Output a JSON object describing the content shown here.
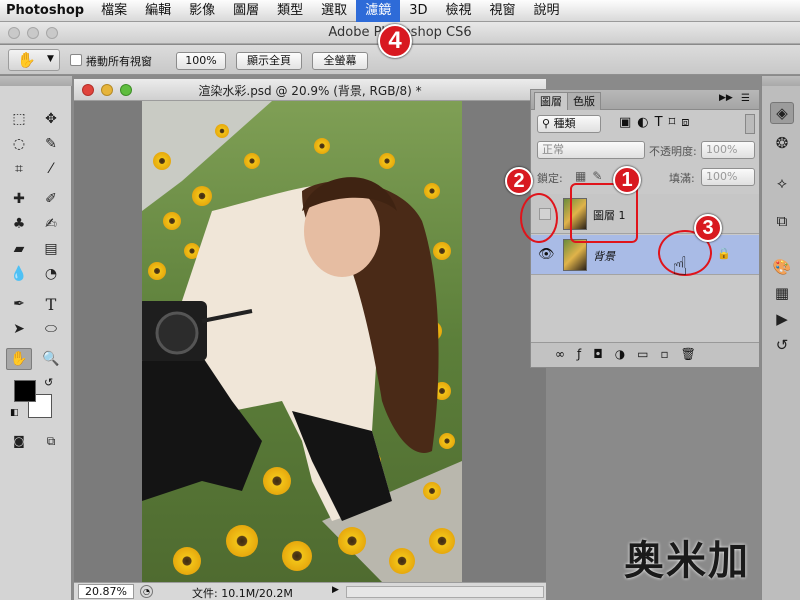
{
  "menubar": {
    "app_name": "Photoshop",
    "items": [
      "檔案",
      "編輯",
      "影像",
      "圖層",
      "類型",
      "選取",
      "濾鏡",
      "3D",
      "檢視",
      "視窗",
      "說明"
    ],
    "active_item": "濾鏡"
  },
  "window": {
    "title": "Adobe Photoshop CS6"
  },
  "options_bar": {
    "scroll_all_label": "捲動所有視窗",
    "btn_100": "100%",
    "btn_fit": "顯示全頁",
    "btn_fill": "全螢幕"
  },
  "document": {
    "title": "渲染水彩.psd @ 20.9% (背景, RGB/8) *",
    "zoom": "20.87%",
    "file_info": "文件: 10.1M/20.2M"
  },
  "layers_panel": {
    "tab_layers": "圖層",
    "tab_channels": "色版",
    "kind_label": "種類",
    "blend_mode": "正常",
    "opacity_label": "不透明度:",
    "opacity_value": "100%",
    "lock_label": "鎖定:",
    "fill_label": "填滿:",
    "fill_value": "100%",
    "layers": [
      {
        "name": "圖層 1",
        "visible": false
      },
      {
        "name": "背景",
        "visible": true,
        "locked": true,
        "selected": true
      }
    ]
  },
  "annotations": [
    "1",
    "2",
    "3",
    "4"
  ],
  "watermark": "奥米加",
  "colors": {
    "accent": "#2e6bd8",
    "annotation_red": "#d81920",
    "layer_selected": "#a9bbe6"
  }
}
